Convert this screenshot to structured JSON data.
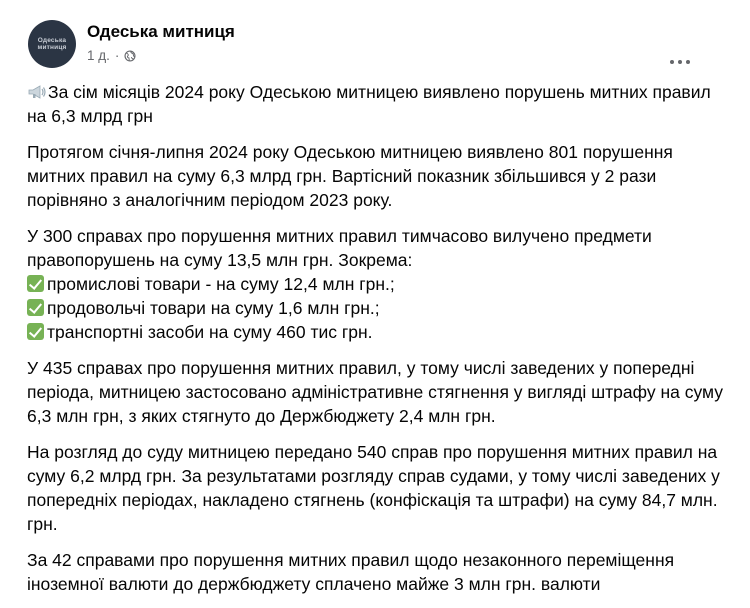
{
  "page": {
    "name": "Одеська митниця",
    "avatar_text": [
      "Одеська",
      "митниця"
    ],
    "timestamp": "1 д.",
    "separator": "·"
  },
  "post": {
    "headline": "За сім місяців 2024 року Одеською митницею виявлено порушень митних правил на 6,3 млрд грн",
    "p1": "Протягом січня-липня 2024 року Одеською митницею виявлено 801 порушення митних правил на суму 6,3 млрд грн. Вартісний показник збільшився у 2 рази порівняно з аналогічним періодом 2023 року.",
    "p2_intro": "У 300 справах про порушення митних правил тимчасово вилучено предмети правопорушень на суму 13,5 млн грн. Зокрема:",
    "p2_items": [
      "промислові товари - на суму 12,4 млн грн.;",
      "продовольчі товари на суму 1,6 млн грн.;",
      "транспортні засоби на суму 460 тис грн."
    ],
    "p3": "У 435 справах про порушення митних правил, у тому числі заведених у попередні періода, митницею застосовано адміністративне стягнення у вигляді штрафу на суму 6,3 млн грн, з яких стягнуто до Держбюджету 2,4 млн грн.",
    "p4": "На розгляд до суду митницею передано 540 справ про порушення митних правил на суму 6,2 млрд грн. За результатами розгляду справ судами, у тому числі заведених у попередніх періодах, накладено стягнень (конфіскація та штрафи) на суму 84,7 млн. грн.",
    "p5": "За 42 справами про порушення митних правил щодо незаконного переміщення іноземної валюти до держбюджету сплачено майже 3 млн грн. валюти"
  },
  "icons": {
    "headline_emoji": "loudspeaker-icon",
    "list_bullet": "check-mark-icon",
    "visibility": "globe-icon",
    "menu": "more-options-icon"
  },
  "colors": {
    "text": "#050505",
    "meta": "#65676b",
    "check": "#77b255",
    "avatar_bg": "#2b3544"
  }
}
